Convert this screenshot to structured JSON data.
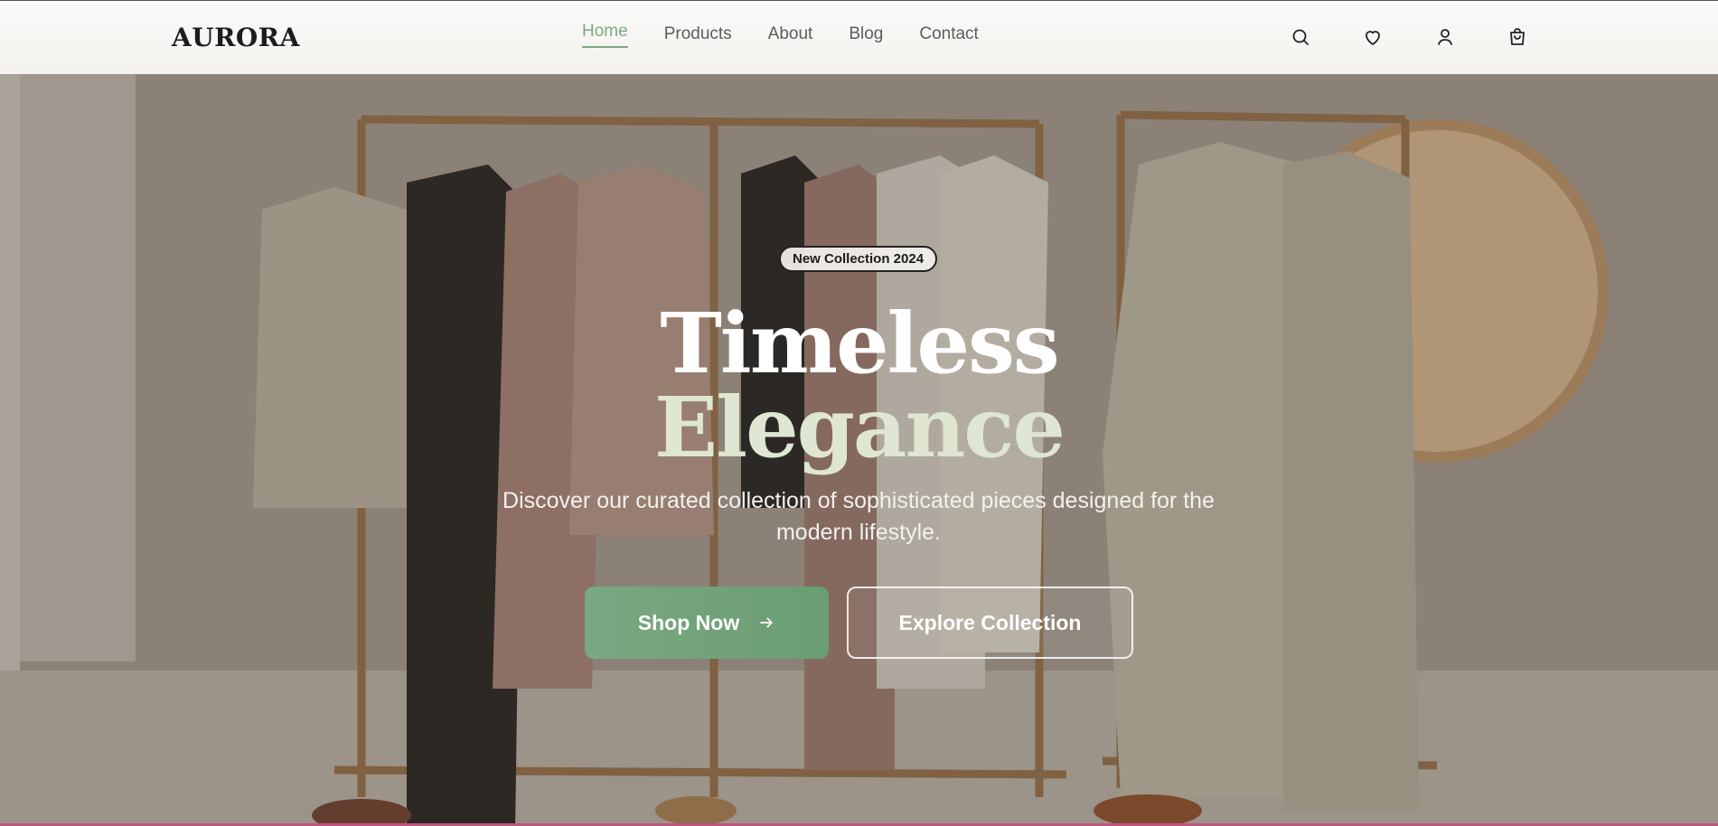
{
  "brand": {
    "logo": "AURORA"
  },
  "nav": {
    "items": [
      {
        "label": "Home",
        "active": true
      },
      {
        "label": "Products",
        "active": false
      },
      {
        "label": "About",
        "active": false
      },
      {
        "label": "Blog",
        "active": false
      },
      {
        "label": "Contact",
        "active": false
      }
    ]
  },
  "header_icons": [
    "search-icon",
    "heart-icon",
    "user-icon",
    "shopping-bag-icon"
  ],
  "hero": {
    "badge": "New Collection 2024",
    "title_line1": "Timeless",
    "title_line2": "Elegance",
    "subtitle": "Discover our curated collection of sophisticated pieces designed for the modern lifestyle.",
    "primary_button": "Shop Now",
    "secondary_button": "Explore Collection"
  },
  "colors": {
    "accent_green": "#7ea884",
    "button_green": "#6a9d72",
    "title_light": "#dfe6d2",
    "bottom_bar": "#c2557f"
  }
}
